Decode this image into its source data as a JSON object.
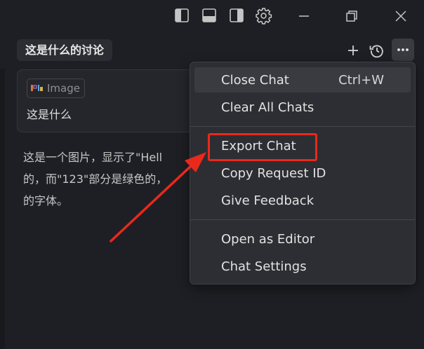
{
  "header": {
    "toolbar_icons": [
      "sidebar-left-icon",
      "panel-bottom-icon",
      "sidebar-right-icon",
      "gear-icon"
    ],
    "window_controls": [
      "minimize-icon",
      "restore-icon",
      "close-icon"
    ]
  },
  "chat": {
    "title": "这是什么的讨论",
    "actions": [
      "plus-icon",
      "history-icon",
      "more-icon"
    ],
    "user_message": {
      "attachment_label": "Image",
      "text": "这是什么"
    },
    "response_lines": [
      "这是一个图片，显示了\"Hell",
      "的，而\"123\"部分是绿色的，",
      "的字体。"
    ]
  },
  "menu": {
    "items": [
      {
        "label": "Close Chat",
        "shortcut": "Ctrl+W"
      },
      {
        "label": "Clear All Chats"
      },
      {
        "label": "Export Chat"
      },
      {
        "label": "Copy Request ID"
      },
      {
        "label": "Give Feedback"
      },
      {
        "label": "Open as Editor"
      },
      {
        "label": "Chat Settings"
      }
    ]
  },
  "annotation": {
    "highlight_color": "#e8291c"
  }
}
